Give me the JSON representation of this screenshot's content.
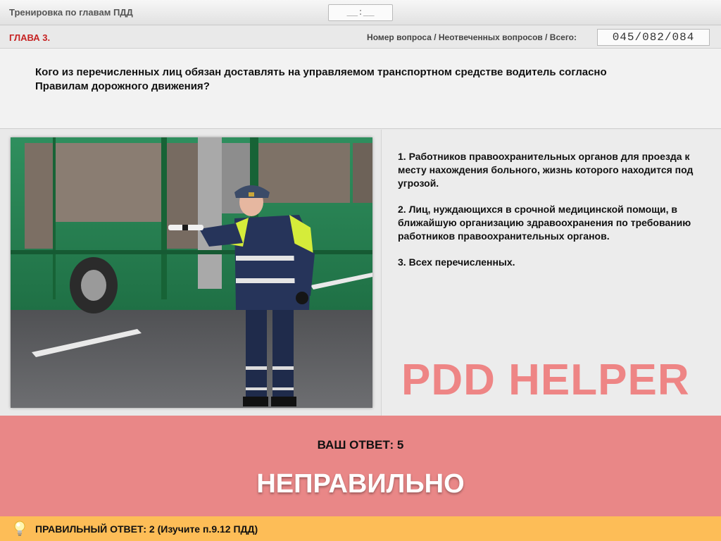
{
  "header": {
    "title": "Тренировка по главам ПДД",
    "timer": "__:__"
  },
  "chapter": {
    "label": "ГЛАВА 3.",
    "counter_label": "Номер вопроса / Неотвеченных вопросов / Всего:",
    "counter_value": "045/082/084"
  },
  "question": {
    "text": "Кого из перечисленных лиц обязан доставлять на управляемом транспортном средстве водитель согласно Правилам дорожного движения?"
  },
  "answers": [
    {
      "text": "1.  Работников правоохранительных органов для проезда к месту нахождения больного, жизнь которого находится под угрозой."
    },
    {
      "text": "2.  Лиц, нуждающихся в срочной медицинской помощи, в ближайшую организацию здравоохранения по требованию работников правоохранительных органов."
    },
    {
      "text": "3.  Всех перечисленных."
    }
  ],
  "brand": "PDD HELPER",
  "result": {
    "your_answer": "ВАШ  ОТВЕТ:   5",
    "verdict": "НЕПРАВИЛЬНО"
  },
  "correct": {
    "text": "ПРАВИЛЬНЫЙ ОТВЕТ:   2   (Изучите п.9.12 ПДД)"
  },
  "colors": {
    "chapter_red": "#c62222",
    "result_bg": "#e98787",
    "correct_bg": "#fdbd57",
    "brand_pink": "#ee8585"
  }
}
